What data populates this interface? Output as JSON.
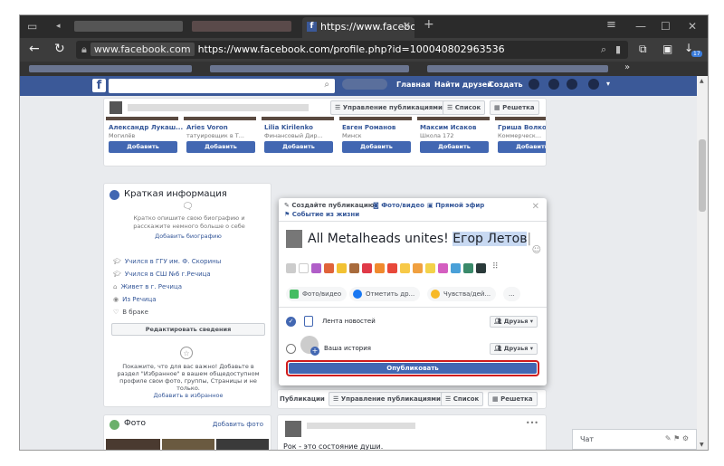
{
  "browser": {
    "tab_title": "https://www.facebook.co",
    "url_domain": "www.facebook.com",
    "url_full": "https://www.facebook.com/profile.php?id=100040802963536",
    "bookmark_overflow": "»",
    "download_badge": "17"
  },
  "fbnav": {
    "logo": "f",
    "links": [
      "Главная",
      "Найти друзей",
      "Создать"
    ]
  },
  "profile_toolbar": {
    "manage_posts": "Управление публикациями",
    "list": "Список",
    "grid": "Решетка"
  },
  "friends": [
    {
      "name": "Александр Лукаш...",
      "sub": "Могилёв",
      "button": "Добавить"
    },
    {
      "name": "Aries Voron",
      "sub": "татуировщик в Т...",
      "button": "Добавить"
    },
    {
      "name": "Lilia Kirilenko",
      "sub": "Финансовый Дир...",
      "button": "Добавить"
    },
    {
      "name": "Евген Романов",
      "sub": "Минск",
      "button": "Добавить"
    },
    {
      "name": "Максим Исаков",
      "sub": "Школа 172",
      "button": "Добавить"
    },
    {
      "name": "Гриша Волков",
      "sub": "Коммерческ...",
      "button": "Добавить"
    }
  ],
  "intro": {
    "title": "Краткая информация",
    "prompt": "Кратко опишите свою биографию и расскажите немного больше о себе",
    "add_bio": "Добавить биографию",
    "items": [
      "Учился в ГГУ им. Ф. Скорины",
      "Учился в СШ №6 г.Речица",
      "Живет в г. Речица",
      "Из Речица",
      "В браке"
    ],
    "edit_button": "Редактировать сведения",
    "featured_text": "Покажите, что для вас важно! Добавьте в раздел \"Избранное\" в вашем общедоступном профиле свои фото, группы, Страницы и не только.",
    "featured_link": "Добавить в избранное"
  },
  "photos": {
    "title": "Фото",
    "add": "Добавить фото"
  },
  "composer": {
    "tab_create": "Создайте публикацию",
    "tab_photo": "Фото/видео",
    "tab_live": "Прямой эфир",
    "tab_life_event": "Событие из жизни",
    "post_text_plain": "All Metalheads unites! ",
    "post_text_selected": "Егор Летов",
    "options": [
      "Фото/видео",
      "Отметить др...",
      "Чувства/дей...",
      "..."
    ],
    "share_targets": [
      {
        "label": "Лента новостей",
        "audience": "Друзья",
        "checked": true
      },
      {
        "label": "Ваша история",
        "audience": "Друзья",
        "checked": false
      }
    ],
    "publish": "Опубликовать"
  },
  "posts_bar": {
    "label": "Публикации",
    "manage": "Управление публикациями",
    "list": "Список",
    "grid": "Решетка"
  },
  "feed_post": {
    "text": "Рок - это состояние души."
  },
  "chat": {
    "label": "Чат"
  },
  "colors": {
    "fb_blue": "#3b5998",
    "button_blue": "#4267b2",
    "highlight_red": "#d01c1c"
  }
}
